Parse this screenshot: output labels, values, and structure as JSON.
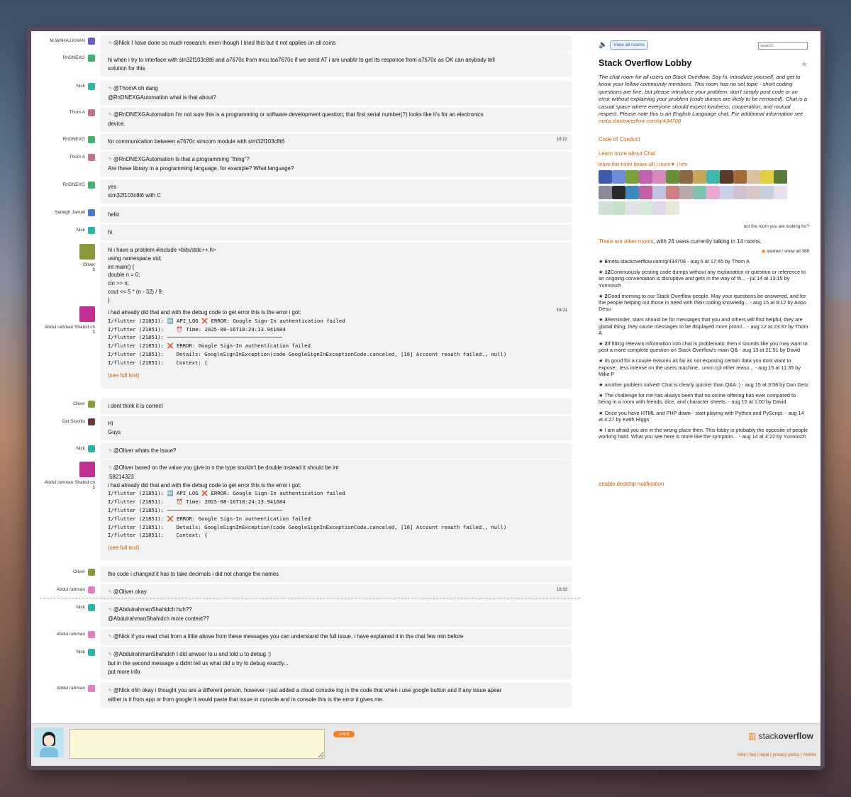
{
  "messages": [
    {
      "user": "M.WAHAJ KHAN",
      "lines": [
        "@Nick I have done so much research. even though I tried this but it not applies on all coins"
      ],
      "reply": true
    },
    {
      "user": "RnDNEXG",
      "lines": [
        "hi when i try to interface with stn32f103c8t6 and a7670c from mcu toa7670c if we send AT i am unable to get its responce from a7670c as OK can anybody tell",
        "solution for this"
      ]
    },
    {
      "user": "Nick",
      "lines": [
        "@ThomA oh dang",
        "@RnDNEXGAutomation what is that about?"
      ],
      "reply": true
    },
    {
      "user": "Thom A",
      "lines": [
        "@RnDNEXGAutomation I'm not sure this is a programming or software development question; that first serial number(?) looks like it's for an electronics",
        "device."
      ],
      "reply": true
    },
    {
      "user": "RnDNEXG",
      "lines": [
        "for communication between a7670c simcom module with stm32f103c8t6"
      ],
      "time": "16:22"
    },
    {
      "user": "Thom A",
      "lines": [
        "@RnDNEXGAutomation Is that a programming \"thing\"?",
        "Are these library in a programming language, for example? What language?"
      ],
      "reply": true
    },
    {
      "user": "RnDNEXG",
      "lines": [
        "yes",
        "stm32f103c8t6 with C"
      ]
    },
    {
      "user": "Sadegh Jamali",
      "lines": [
        "hello"
      ]
    },
    {
      "user": "Nick",
      "lines": [
        "hi"
      ]
    },
    {
      "user": "Oliver",
      "rep": "1",
      "lines": [
        "hi i have a problem #include <bits/stdc++.h>",
        "using namespace std;",
        "int main() {",
        "double n = 0;",
        "cin >> n;",
        "cout << 5 * (n - 32) / 9;",
        "}"
      ]
    },
    {
      "user": "Abdul rahman Shahid ch",
      "rep": "1",
      "time": "16:31",
      "lines": [
        "i had already did that and with the debug code to get error this is the error i got:",
        "I/flutter (21851): 🆗 API_LOG ❌ ERROR: Google Sign-In authentication failed",
        "I/flutter (21851):    ⏰ Time: 2025-08-16T18:24:13.941684",
        "I/flutter (21851): ─────────────────────────────────────",
        "I/flutter (21851): ❌ ERROR: Google Sign-In authentication failed",
        "I/flutter (21851):    Details: GoogleSignInException(code GoogleSignInExceptionCode.canceled, [16] Account reauth failed., null)",
        "I/flutter (21851):    Context: {"
      ],
      "more": "(see full text)"
    },
    {
      "user": "Oliver",
      "lines": [
        "i dont think it is correct"
      ]
    },
    {
      "user": "Cel Sionillo",
      "lines": [
        "Hi",
        "Guys"
      ]
    },
    {
      "user": "Nick",
      "lines": [
        "@Oliver whats the issue?"
      ],
      "reply": true
    },
    {
      "user": "Abdul rahman Shahid ch",
      "rep": "1",
      "lines": [
        "@Oliver based on the value you give to n the type souldn't be double instead it should be int",
        "",
        ":58214323",
        "i had already did that and with the debug code to get error this is the error i got:",
        "I/flutter (21851): 🆗 API_LOG ❌ ERROR: Google Sign-In authentication failed",
        "I/flutter (21851):    ⏰ Time: 2025-08-16T18:24:13.941684",
        "I/flutter (21851): ─────────────────────────────────────",
        "I/flutter (21851): ❌ ERROR: Google Sign-In authentication failed",
        "I/flutter (21851):    Details: GoogleSignInException(code GoogleSignInExceptionCode.canceled, [16] Account reauth failed., null)",
        "I/flutter (21851):    Context: {"
      ],
      "more": "(see full text)",
      "reply": true
    },
    {
      "user": "Oliver",
      "lines": [
        "the code i changed it has to take decimals i did not change the names"
      ]
    },
    {
      "user": "Abdul rahman",
      "lines": [
        "@Oliver okay"
      ],
      "time": "16:33",
      "reply": true
    },
    {
      "user": "Nick",
      "lines": [
        "@AbdulrahmanShahidch huh??",
        "@AbdulrahmanShahidch more context??"
      ],
      "reply": true
    },
    {
      "user": "Abdul rahman",
      "lines": [
        "@Nick if you read chat from a little above from these messages you can understand the full issue, i have explained it in the chat few min before"
      ],
      "reply": true
    },
    {
      "user": "Nick",
      "lines": [
        "@AbdulrahmanShahidch I did anwser to u and told u to debug :)",
        "but in the second message u didnt tell us what did u try to debug exactly...",
        "put more info"
      ],
      "reply": true
    },
    {
      "user": "Abdul rahman",
      "lines": [
        "@Nick ohh okay i thought you are a different person, however i just added a cloud console log in the code that when i use google button and if any issue apear",
        "either is it from app or from google it would paste that issue in console and in console this is the error it gives me."
      ],
      "reply": true
    }
  ],
  "sidebar": {
    "view_all": "View all rooms",
    "search_placeholder": "search",
    "title": "Stack Overflow Lobby",
    "description": "The chat room for all users on Stack Overflow. Say hi, introduce yourself, and get to know your fellow community members. This room has no set topic - short coding questions are fine, but please introduce your problem; don't simply post code or an error without explaining your problem (code dumps are likely to be removed). Chat is a casual space where everyone should expect kindness, cooperation, and mutual respect. Please note this is an English Language chat. For additional information see",
    "desc_link": "meta.stackoverflow.com/q/434708",
    "code_of_conduct": "Code of Conduct",
    "learn_more": "Learn more about Chat",
    "room_links": "leave this room (leave all) | room▼ | info",
    "not_room": "not the room you are looking for?",
    "other_rooms": "There are other rooms",
    "other_rooms_rest": ", with 24 users currently talking in 14 rooms.",
    "starred_label": "starred / show all 388",
    "starred": [
      {
        "n": "6",
        "text": "meta.stackoverflow.com/q/434708 - aug 6 at 17:45 by Thom A"
      },
      {
        "n": "12",
        "text": "Continuously posting code dumps without any explanation or question or reference to an ongoing conversation is disruptive and gets in the way of th... - jul 14 at 13:15 by Yunnosch"
      },
      {
        "n": "2",
        "text": "Good morning to our Stack Overflow people. May your questions be answered, and for the people helping out those in need with their coding knowledg... - aug 15 at 8:12 by Anpo Desu"
      },
      {
        "n": "3",
        "text": "Reminder, stars should be for messages that you and others will find helpful, they are global thing; they cause messages to be displayed more promi... - aug 12 at 23:37 by Thom A"
      },
      {
        "n": "2",
        "text": "If fitting relevant information into chat is problematic then it sounds like you may want to post a more complete question on Stack Overflow's main Q& - aug 13 at 21:51 by David"
      },
      {
        "n": "",
        "text": "its good for a couple reasons as far as not exposing certain data you dont want to expose.. less intense on the users machine.. umm cpl other reaso... - aug 15 at 11:35 by Mike P"
      },
      {
        "n": "",
        "text": "another problem solved! Chat is clearly quicker than Q&A :) - aug 15 at 3:58 by Dan Getz"
      },
      {
        "n": "",
        "text": "The challenge for me has always been that no online offering has ever compared to being in a room with friends, dice, and character sheets. - aug 15 at 1:00 by David"
      },
      {
        "n": "",
        "text": "Once you have HTML and PHP down - start playing with Python and PyScript. - aug 14 at 4:27 by Keith Higgs"
      },
      {
        "n": "",
        "text": "I am afraid you are in the wrong place then. This lobby is probably the opposite of people working hard. What you see here is more like the symptom... - aug 14 at 4:22 by Yunnosch"
      }
    ],
    "desktop_notif": "enable desktop notification"
  },
  "footer": {
    "send": "send",
    "logo_a": "stack",
    "logo_b": "overflow",
    "links": "help | faq | legal | privacy policy | mobile"
  },
  "colors": {
    "accent": "#f48024",
    "link": "#c7620c",
    "bubble": "#f3f3f3"
  }
}
